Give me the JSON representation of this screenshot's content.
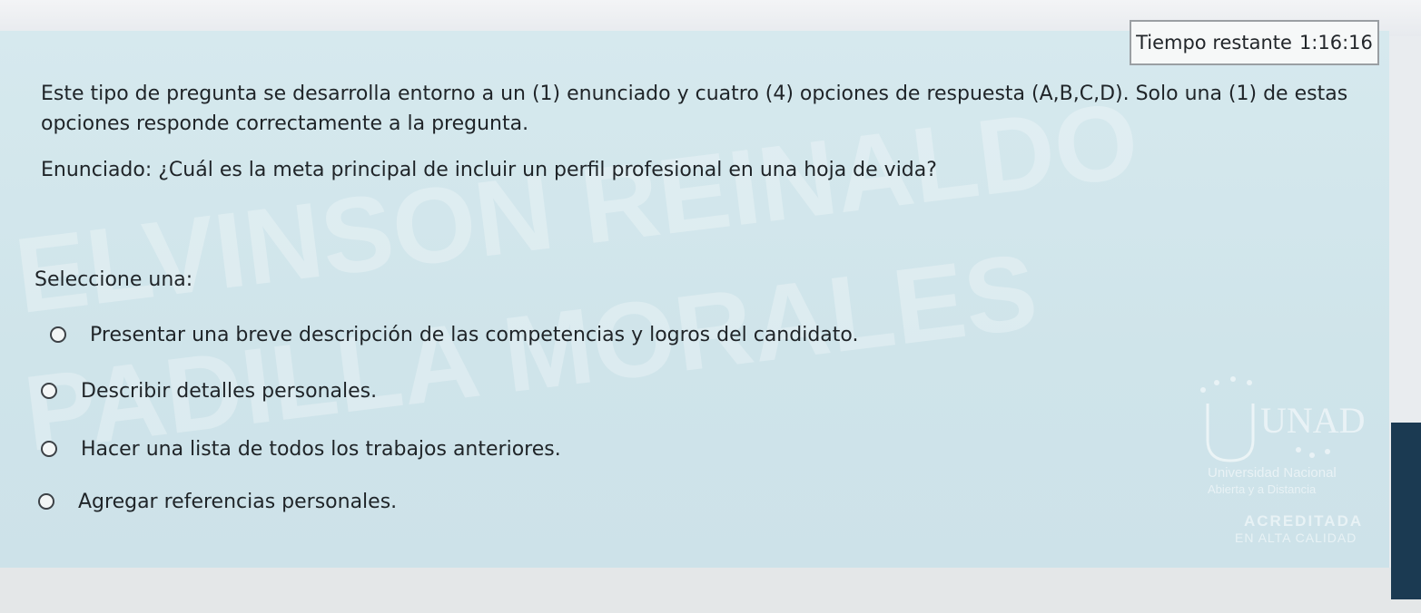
{
  "timer": {
    "label": "Tiempo restante",
    "value": "1:16:16"
  },
  "instructions": "Este tipo de pregunta se desarrolla entorno a un (1) enunciado y cuatro (4) opciones de respuesta (A,B,C,D). Solo una (1) de estas opciones responde correctamente a la pregunta.",
  "question": "Enunciado: ¿Cuál es la meta principal de incluir un perfil profesional en una hoja de vida?",
  "select_label": "Seleccione una:",
  "options": [
    "Presentar una breve descripción de las competencias y logros del candidato.",
    "Describir detalles personales.",
    "Hacer una lista de todos los trabajos anteriores.",
    "Agregar referencias personales."
  ],
  "watermark": {
    "line1": "ELVINSON REINALDO",
    "line2": "PADILLA MORALES"
  },
  "logo": {
    "name": "UNAD",
    "subtitle1": "Universidad Nacional",
    "subtitle2": "Abierta y a Distancia",
    "badge1": "ACREDITADA",
    "badge2": "EN ALTA CALIDAD"
  },
  "colors": {
    "panel": "#d3e7ec",
    "text": "#1f2428",
    "timer_border": "#9a9fa3"
  }
}
